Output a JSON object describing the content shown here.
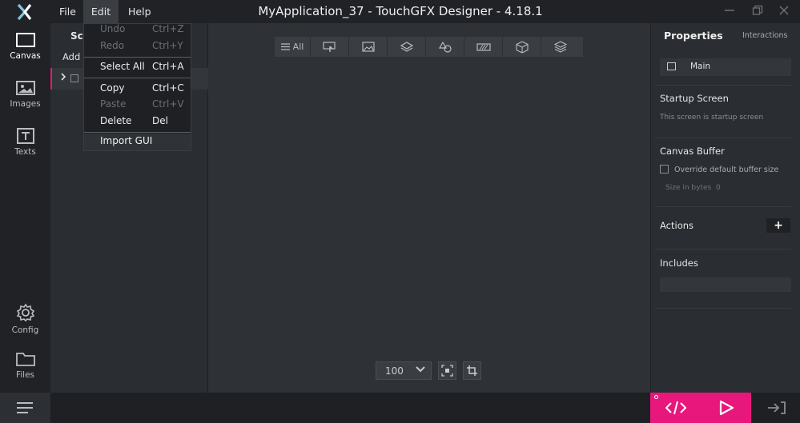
{
  "titlebar": {
    "menus": [
      "File",
      "Edit",
      "Help"
    ],
    "title": "MyApplication_37 - TouchGFX Designer - 4.18.1"
  },
  "leftrail": {
    "items": [
      {
        "label": "Canvas",
        "icon": "canvas-icon"
      },
      {
        "label": "Images",
        "icon": "image-icon"
      },
      {
        "label": "Texts",
        "icon": "text-icon"
      },
      {
        "label": "Config",
        "icon": "gear-icon"
      },
      {
        "label": "Files",
        "icon": "folder-icon"
      }
    ]
  },
  "screens": {
    "heading": "Scr",
    "add_label": "Add S"
  },
  "toolbar": {
    "all_label": "All",
    "filters": [
      "touch-icon",
      "image-icon",
      "layers-icon",
      "shapes-icon",
      "progress-icon",
      "3d-box-icon",
      "stack-icon"
    ]
  },
  "canvas": {
    "zoom": "100"
  },
  "properties": {
    "tab_properties": "Properties",
    "tab_interactions": "Interactions",
    "screen_name": "Main",
    "startup_title": "Startup Screen",
    "startup_sub": "This screen is startup screen",
    "canvas_buffer_title": "Canvas Buffer",
    "override_label": "Override default buffer size",
    "size_label": "Size in bytes",
    "size_value": "0",
    "actions_title": "Actions",
    "actions_add": "+",
    "includes_title": "Includes"
  },
  "edit_menu": {
    "items": [
      {
        "label": "Undo",
        "shortcut": "Ctrl+Z",
        "enabled": false
      },
      {
        "label": "Redo",
        "shortcut": "Ctrl+Y",
        "enabled": false
      },
      {
        "label": "Select All",
        "shortcut": "Ctrl+A",
        "enabled": true
      },
      {
        "label": "Copy",
        "shortcut": "Ctrl+C",
        "enabled": true
      },
      {
        "label": "Paste",
        "shortcut": "Ctrl+V",
        "enabled": false
      },
      {
        "label": "Delete",
        "shortcut": "Del",
        "enabled": true
      },
      {
        "label": "Import GUI",
        "shortcut": "",
        "enabled": true
      }
    ]
  },
  "colors": {
    "accent": "#e8177c",
    "background": "#2c2f33",
    "rail": "#202226"
  }
}
